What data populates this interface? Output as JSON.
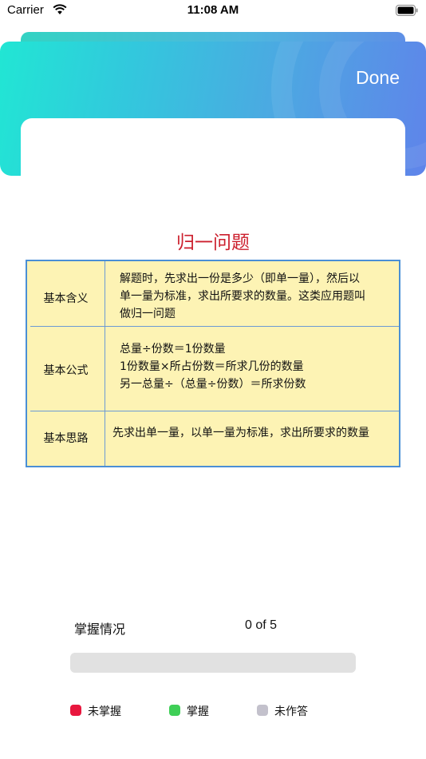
{
  "status_bar": {
    "carrier": "Carrier",
    "time": "11:08 AM"
  },
  "modal": {
    "done_label": "Done"
  },
  "content": {
    "title": "归一问题",
    "rows": [
      {
        "label": "基本含义",
        "lines": [
          "解题时，先求出一份是多少（即单一量），然后以",
          "单一量为标准，求出所要求的数量。这类应用题叫",
          "做归一问题"
        ]
      },
      {
        "label": "基本公式",
        "lines": [
          "总量÷份数＝1份数量",
          "1份数量×所占份数＝所求几份的数量",
          "另一总量÷（总量÷份数）＝所求份数"
        ]
      },
      {
        "label": "基本思路",
        "lines": [
          "先求出单一量，以单一量为标准，求出所要求的数量"
        ]
      }
    ]
  },
  "mastery": {
    "label": "掌握情况",
    "count_text": "0 of 5",
    "progress_fraction": 0,
    "legend": [
      {
        "label": "未掌握",
        "color": "#e8173e"
      },
      {
        "label": "掌握",
        "color": "#3fcf57"
      },
      {
        "label": "未作答",
        "color": "#c3c1cc"
      }
    ]
  },
  "colors": {
    "header_gradient_start": "#21e6d4",
    "header_gradient_end": "#5f84ea",
    "title_red": "#cc1f2d",
    "table_border": "#4a8fd6",
    "table_fill": "#fdf3b4"
  }
}
